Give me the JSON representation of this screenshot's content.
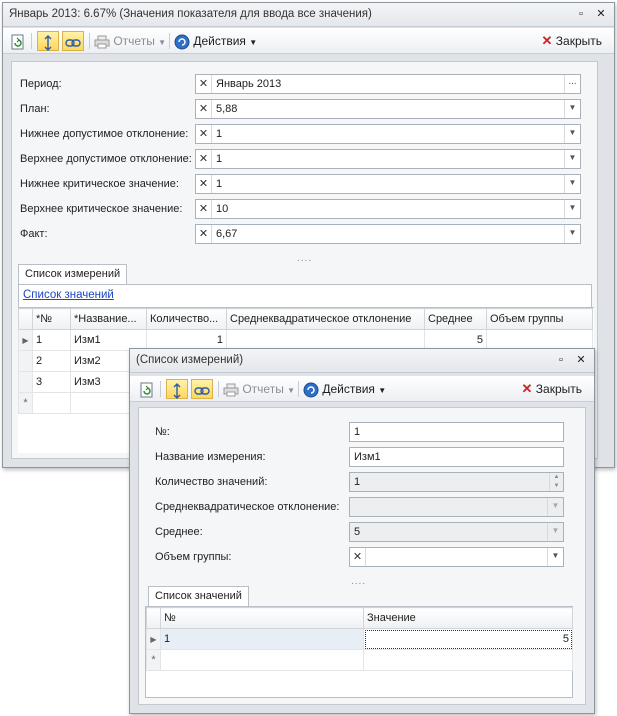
{
  "main": {
    "title": "Январь 2013: 6.67% (Значения показателя для ввода все значения)",
    "toolbar": {
      "reports": "Отчеты",
      "actions": "Действия",
      "close": "Закрыть"
    },
    "fields": [
      {
        "label": "Период:",
        "value": "Январь 2013",
        "button": "..."
      },
      {
        "label": "План:",
        "value": "5,88"
      },
      {
        "label": "Нижнее допустимое отклонение:",
        "value": "1"
      },
      {
        "label": "Верхнее допустимое отклонение:",
        "value": "1"
      },
      {
        "label": "Нижнее критическое значение:",
        "value": "1"
      },
      {
        "label": "Верхнее критическое значение:",
        "value": "10"
      },
      {
        "label": "Факт:",
        "value": "6,67"
      }
    ],
    "dots": "....",
    "tab": "Список измерений",
    "link": "Список значений",
    "columns": [
      "*№",
      "*Название...",
      "Количество...",
      "Среднеквадратическое отклонение",
      "Среднее",
      "Объем группы"
    ],
    "rows": [
      {
        "num": "1",
        "name": "Изм1",
        "count": "1",
        "std": "",
        "avg": "5",
        "group": ""
      },
      {
        "num": "2",
        "name": "Изм2",
        "count": "",
        "std": "",
        "avg": "",
        "group": ""
      },
      {
        "num": "3",
        "name": "Изм3",
        "count": "",
        "std": "",
        "avg": "",
        "group": ""
      }
    ],
    "new_row_marker": "*"
  },
  "dialog": {
    "title": "(Список измерений)",
    "toolbar": {
      "reports": "Отчеты",
      "actions": "Действия",
      "close": "Закрыть"
    },
    "fields": [
      {
        "label": "№:",
        "value": "1"
      },
      {
        "label": "Название измерения:",
        "value": "Изм1"
      },
      {
        "label": "Количество значений:",
        "value": "1"
      },
      {
        "label": "Среднеквадратическое отклонение:",
        "value": ""
      },
      {
        "label": "Среднее:",
        "value": "5"
      },
      {
        "label": "Объем группы:",
        "value": ""
      }
    ],
    "dots": "....",
    "tab": "Список значений",
    "columns": [
      "№",
      "Значение"
    ],
    "rows": [
      {
        "num": "1",
        "value": "5"
      }
    ],
    "new_row_marker": "*"
  },
  "colors": {
    "accent_pressed": "#ffd65c",
    "link": "#1a46c8",
    "close_x": "#d02020"
  }
}
